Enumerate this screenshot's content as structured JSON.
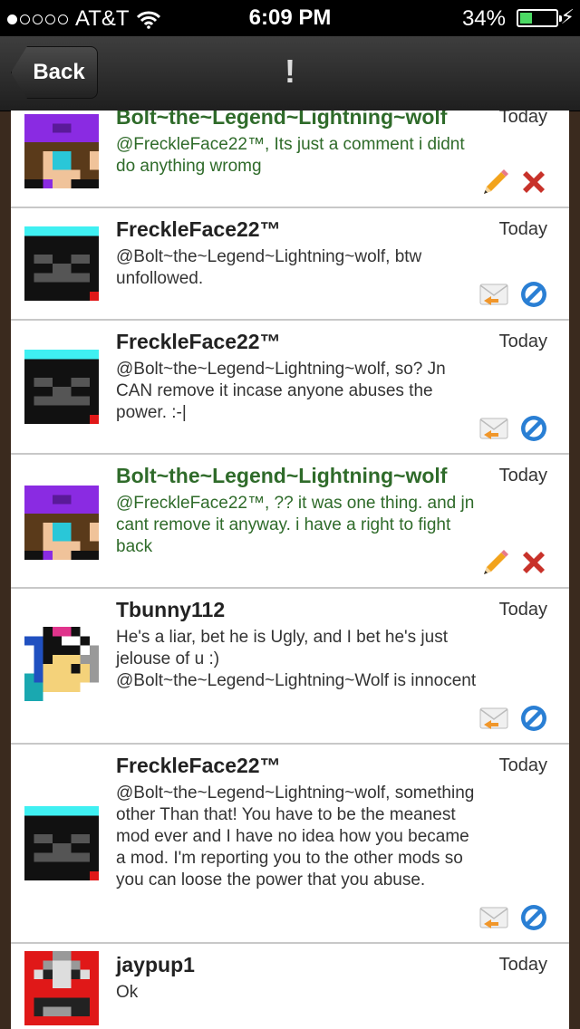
{
  "status_bar": {
    "carrier": "AT&T",
    "time": "6:09 PM",
    "battery_percent": "34%",
    "battery_level": 0.34,
    "signal_bars": 1
  },
  "nav": {
    "back_label": "Back",
    "title": "!"
  },
  "comments": [
    {
      "author": "Bolt~the~Legend~Lightning~wolf",
      "date": "Today",
      "text": "@FreckleFace22™, Its just a comment i didnt do anything wromg",
      "own": true
    },
    {
      "author": "FreckleFace22™",
      "date": "Today",
      "text": "@Bolt~the~Legend~Lightning~wolf, btw unfollowed.",
      "own": false
    },
    {
      "author": "FreckleFace22™",
      "date": "Today",
      "text": "@Bolt~the~Legend~Lightning~wolf, so? Jn CAN remove it incase anyone abuses the power. :-|",
      "own": false
    },
    {
      "author": "Bolt~the~Legend~Lightning~wolf",
      "date": "Today",
      "text": "@FreckleFace22™, ?? it was one thing. and jn cant remove it anyway. i have a right to fight back",
      "own": true
    },
    {
      "author": "Tbunny112",
      "date": "Today",
      "text": "He's a liar, bet he is Ugly, and I bet he's just jelouse of u :) @Bolt~the~Legend~Lightning~Wolf is innocent",
      "own": false
    },
    {
      "author": "FreckleFace22™",
      "date": "Today",
      "text": "@Bolt~the~Legend~Lightning~wolf, something other Than that! You have to be the meanest mod ever and I have no idea how you became a mod. I'm reporting you to the other mods so you can loose the power that you abuse.",
      "own": false
    },
    {
      "author": "jaypup1",
      "date": "Today",
      "text": "Ok",
      "own": false
    }
  ],
  "icons": {
    "own_actions": [
      "edit-pencil-icon",
      "delete-x-icon"
    ],
    "other_actions": [
      "reply-envelope-icon",
      "block-icon"
    ]
  },
  "colors": {
    "own_author": "#2f6b2a",
    "battery_fill": "#4cd964",
    "block_blue": "#2a7fd4",
    "delete_red": "#c8322a"
  }
}
